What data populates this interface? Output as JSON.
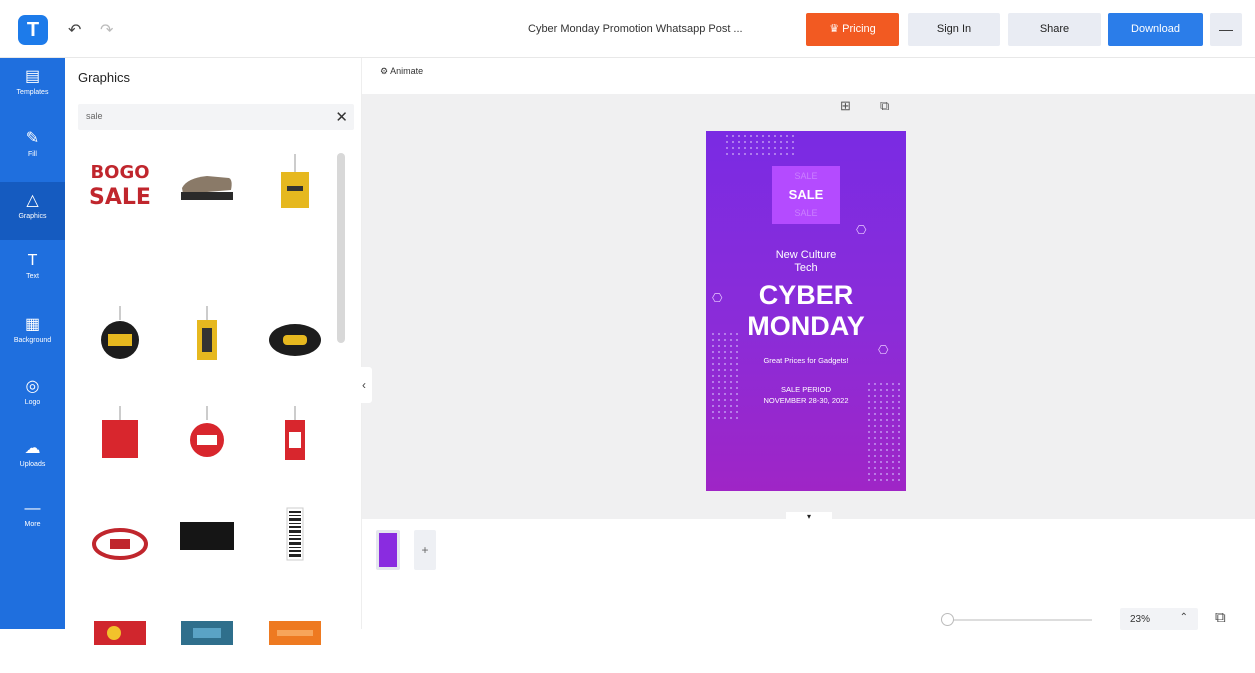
{
  "header": {
    "doc_title": "Cyber Monday Promotion Whatsapp Post ...",
    "pricing_label": "Pricing",
    "signin_label": "Sign In",
    "share_label": "Share",
    "download_label": "Download",
    "more_label": "—",
    "accent": "#f25a22",
    "primary": "#2b7de9"
  },
  "sidebar": {
    "items": [
      {
        "label": "Templates",
        "icon": "templates-icon",
        "glyph": "▤"
      },
      {
        "label": "Fill",
        "icon": "brush-icon",
        "glyph": "✎"
      },
      {
        "label": "Graphics",
        "icon": "shapes-icon",
        "glyph": "△"
      },
      {
        "label": "Text",
        "icon": "text-icon",
        "glyph": "T"
      },
      {
        "label": "Background",
        "icon": "background-icon",
        "glyph": "▦"
      },
      {
        "label": "Logo",
        "icon": "logo-icon",
        "glyph": "◎"
      },
      {
        "label": "Uploads",
        "icon": "upload-icon",
        "glyph": "☁"
      },
      {
        "label": "More",
        "icon": "more-icon",
        "glyph": "—"
      }
    ],
    "active_index": 2
  },
  "panel": {
    "title": "Graphics",
    "search_value": "sale"
  },
  "canvas": {
    "animate_label": "Animate",
    "poster": {
      "sale_label": "SALE",
      "tagline_1": "New Culture",
      "tagline_2": "Tech",
      "headline_1": "CYBER",
      "headline_2": "MONDAY",
      "subtitle": "Great Prices for Gadgets!",
      "period_label": "SALE PERIOD",
      "period_dates": "NOVEMBER 28-30, 2022"
    }
  },
  "pages": {
    "add_label": "+"
  },
  "zoom": {
    "value": "23%",
    "level": 0.02
  }
}
